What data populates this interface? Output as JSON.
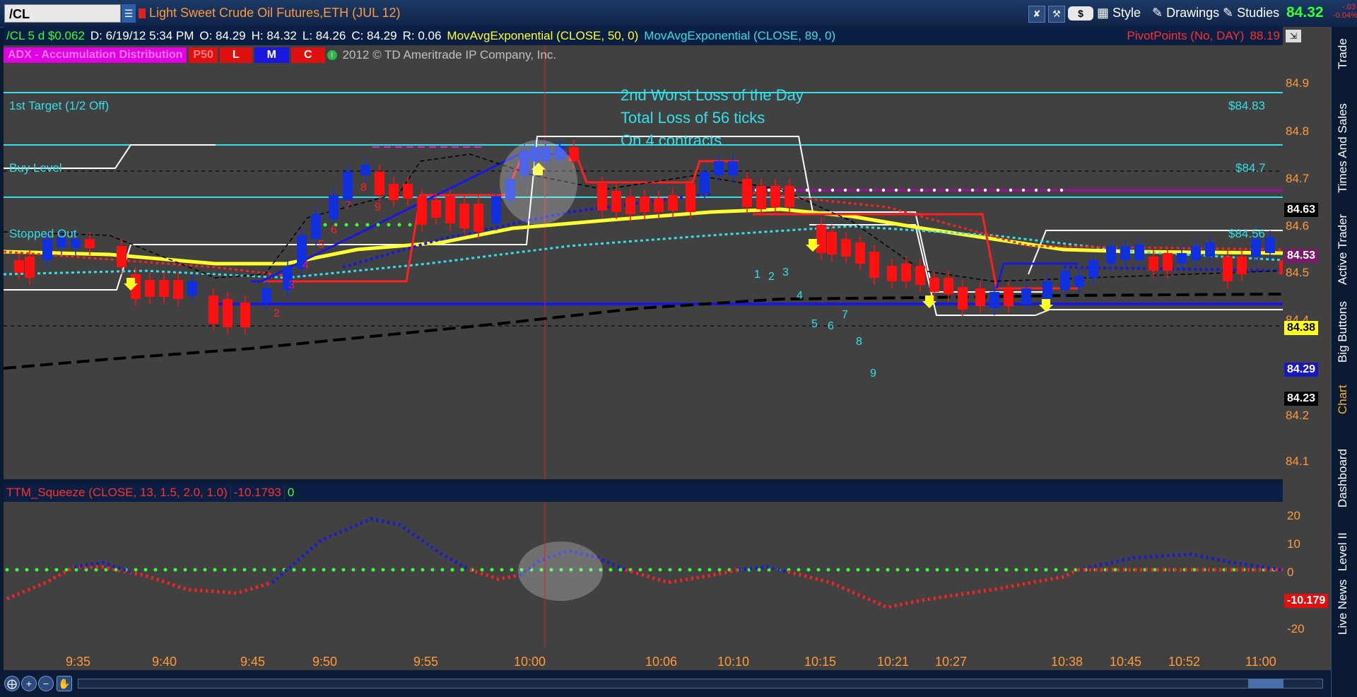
{
  "toolbar": {
    "symbol": "/CL",
    "description": "Light Sweet Crude Oil Futures,ETH (JUL 12)",
    "dollar_label": "$",
    "style_label": "Style",
    "drawings_label": "Drawings",
    "studies_label": "Studies",
    "last_price": "84.32",
    "change_1": "-.03",
    "change_2": "-0.04%"
  },
  "header": {
    "instrument": "/CL 5 d $0.062",
    "date": "D: 6/19/12 5:34 PM",
    "open": "O: 84.29",
    "high": "H: 84.32",
    "low": "L: 84.26",
    "close": "C: 84.29",
    "range": "R: 0.06",
    "ma1": "MovAvgExponential (CLOSE, 50, 0)",
    "ma2": "MovAvgExponential (CLOSE, 89, 0)",
    "pivot": "PivotPoints (No, DAY)",
    "pivot_value": "88.19",
    "adx_label": "ADX - Accumulation Distribution",
    "badge_p50": "P50",
    "badge_l": "L",
    "badge_m": "M",
    "badge_c": "C",
    "copyright": "2012 © TD Ameritrade IP Company, Inc."
  },
  "annotation": {
    "line1": "2nd Worst Loss of the Day",
    "line2": "Total Loss of 56 ticks",
    "line3": "On 4 contracts"
  },
  "levels": {
    "target_label": "1st Target (1/2 Off)",
    "target_price": "$84.83",
    "buy_label": "Buy Level",
    "buy_price": "$84.7",
    "stop_label": "Stopped Out",
    "stop_price": "$84.56"
  },
  "price_boxes": {
    "p1": "84.63",
    "p2": "84.53",
    "p3": "84.38",
    "p4": "84.29",
    "p5": "84.23"
  },
  "y_axis": [
    "84.9",
    "84.8",
    "84.7",
    "84.6",
    "84.5",
    "84.4",
    "84.2",
    "84.1"
  ],
  "ttm": {
    "label": "TTM_Squeeze (CLOSE, 13, 1.5, 2.0, 1.0)",
    "value": "-10.1793",
    "squeeze": "0",
    "axis": [
      "20",
      "10",
      "0",
      "-20"
    ],
    "current": "-10.179"
  },
  "x_axis": [
    "9:35",
    "9:40",
    "9:45",
    "9:50",
    "9:55",
    "10:00",
    "10:06",
    "10:10",
    "10:15",
    "10:21",
    "10:27",
    "10:38",
    "10:45",
    "10:52",
    "11:00"
  ],
  "counts_red": [
    "2",
    "3",
    "4",
    "5",
    "6",
    "7",
    "8",
    "9"
  ],
  "counts_cyan": [
    "1",
    "2",
    "3",
    "4",
    "5",
    "6",
    "7",
    "8",
    "9"
  ],
  "side_tabs": [
    "Trade",
    "Times And Sales",
    "Active Trader",
    "Big Buttons",
    "Chart",
    "Dashboard",
    "Level II",
    "Live News"
  ],
  "colors": {
    "accent_cyan": "#34e0e8",
    "bull_blue": "#1030e0",
    "bear_red": "#ff1010",
    "axis_orange": "#ff9a3a"
  }
}
